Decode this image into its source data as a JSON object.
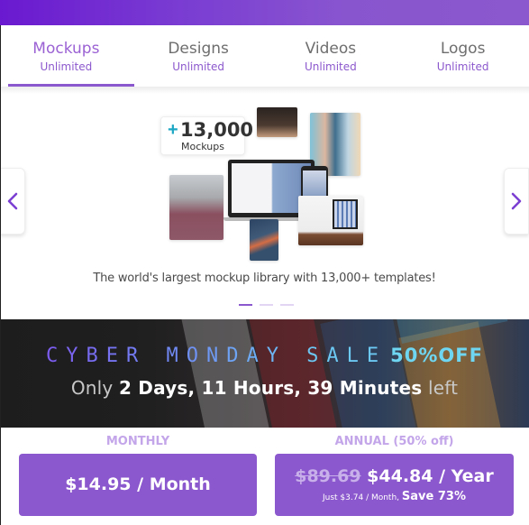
{
  "tabs": [
    {
      "title": "Mockups",
      "subtitle": "Unlimited",
      "active": true
    },
    {
      "title": "Designs",
      "subtitle": "Unlimited",
      "active": false
    },
    {
      "title": "Videos",
      "subtitle": "Unlimited",
      "active": false
    },
    {
      "title": "Logos",
      "subtitle": "Unlimited",
      "active": false
    }
  ],
  "carousel": {
    "count_plus": "+",
    "count_number": "13,000",
    "count_label": "Mockups",
    "caption": "The world's largest mockup library with 13,000+ templates!",
    "prev_icon": "‹",
    "next_icon": "›",
    "slides_total": 3,
    "active_slide": 1
  },
  "banner": {
    "title": "CYBER MONDAY SALE",
    "discount": "50%OFF",
    "sub_prefix": "Only",
    "countdown": "2 Days, 11 Hours, 39 Minutes",
    "sub_suffix": "left"
  },
  "pricing": {
    "monthly": {
      "label": "MONTHLY",
      "price": "$14.95 / Month"
    },
    "annual": {
      "label": "ANNUAL (50% off)",
      "old_price": "$89.69",
      "price": "$44.84 / Year",
      "sub_text": "Just $3.74 / Month,",
      "save_text": "Save 73%"
    }
  },
  "colors": {
    "accent": "#8c58cd",
    "header_start": "#6a19d0",
    "banner_highlight": "#6fd6f2",
    "count_plus": "#1da7c4"
  }
}
